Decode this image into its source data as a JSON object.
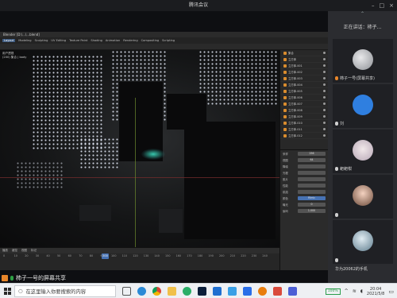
{
  "meeting": {
    "title": "腾讯会议"
  },
  "blender": {
    "title": "Blender [D:\\...\\...blend]",
    "menus": [
      "Layout",
      "Modeling",
      "Sculpting",
      "UV Editing",
      "Texture Paint",
      "Shading",
      "Animation",
      "Rendering",
      "Compositing",
      "Scripting"
    ],
    "active_menu": "Layout",
    "viewport_info": "用户透视\n(200) 集合 | body",
    "timeline_menus": [
      "播放",
      "键控",
      "视图",
      "标记"
    ],
    "frame_ticks": [
      "0",
      "10",
      "20",
      "30",
      "40",
      "50",
      "60",
      "70",
      "80",
      "90",
      "100",
      "110",
      "120",
      "130",
      "140",
      "150",
      "160",
      "170",
      "180",
      "190",
      "200",
      "210",
      "220",
      "230",
      "240"
    ],
    "current_frame": "200",
    "outliner_items": [
      "集合",
      "立方体",
      "立方体.001",
      "立方体.002",
      "立方体.003",
      "立方体.004",
      "立方体.005",
      "立方体.006",
      "立方体.007",
      "立方体.008",
      "立方体.009",
      "立方体.010",
      "立方体.011",
      "立方体.012"
    ],
    "properties": [
      {
        "k": "采样",
        "v": "256"
      },
      {
        "k": "视图",
        "v": "64"
      },
      {
        "k": "降噪",
        "v": ""
      },
      {
        "k": "光程",
        "v": ""
      },
      {
        "k": "胶片",
        "v": ""
      },
      {
        "k": "性能",
        "v": ""
      },
      {
        "k": "烘焙",
        "v": ""
      },
      {
        "k": "颜色",
        "v": "Filmic"
      },
      {
        "k": "曝光",
        "v": "0"
      },
      {
        "k": "伽玛",
        "v": "1.000"
      }
    ]
  },
  "share_banner": "柿子一号的屏幕共享",
  "panel": {
    "header": "正在讲话：柿子...",
    "participants": [
      {
        "name": "柿子一号(屏幕共享)"
      },
      {
        "name": "刘"
      },
      {
        "name": "耙耙柑"
      },
      {
        "name": ""
      },
      {
        "name": ""
      },
      {
        "name": "华为20062的手机"
      }
    ]
  },
  "taskbar": {
    "search_placeholder": "在这里输入你要搜索的内容",
    "battery": "100%",
    "time": "20:04",
    "date": "2021/5/8"
  }
}
